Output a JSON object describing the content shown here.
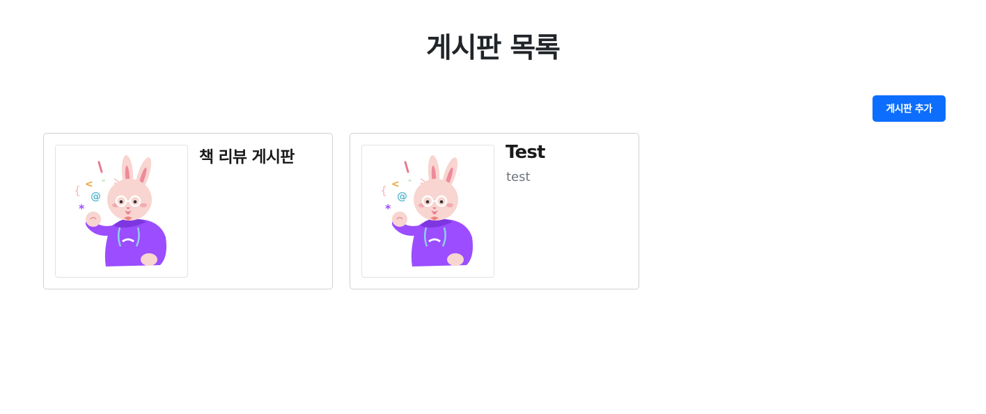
{
  "page": {
    "title": "게시판 목록"
  },
  "toolbar": {
    "add_label": "게시판 추가"
  },
  "boards": [
    {
      "title": "책 리뷰 게시판",
      "description": "",
      "image_icon": "rabbit-coder-illustration"
    },
    {
      "title": "Test",
      "description": "test",
      "image_icon": "rabbit-coder-illustration"
    }
  ],
  "colors": {
    "primary": "#0d6efd",
    "rabbit": "#f8d5d0",
    "hoodie": "#9b4dff"
  }
}
